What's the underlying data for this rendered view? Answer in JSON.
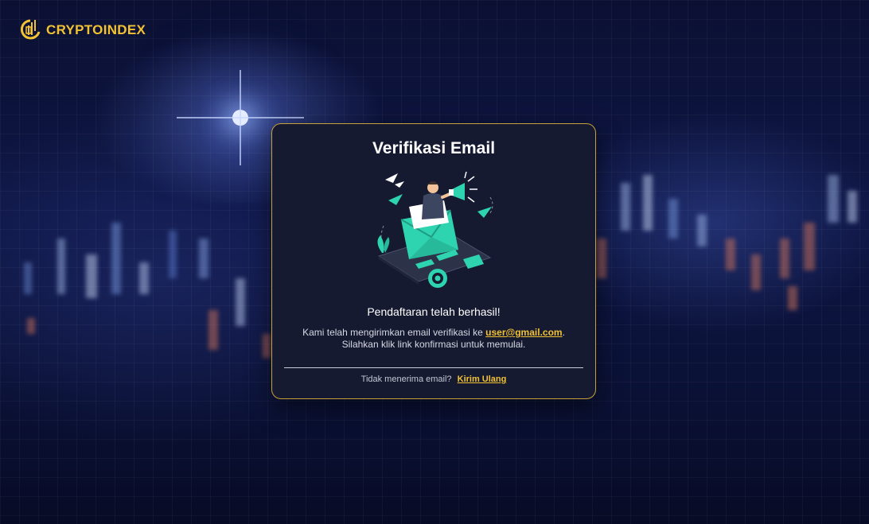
{
  "brand": {
    "name": "CRYPTOINDEX",
    "logo_icon": "coin-chart-icon",
    "accent_color": "#f2c233"
  },
  "card": {
    "title": "Verifikasi Email",
    "illustration": "email-megaphone-illustration",
    "success_message": "Pendaftaran telah berhasil!",
    "info_prefix": "Kami telah mengirimkan email verifikasi ke",
    "email": "user@gmail.com",
    "info_suffix": ".",
    "info_line2": "Silahkan klik link konfirmasi untuk memulai.",
    "footer_prompt": "Tidak menerima email?",
    "resend_label": "Kirim Ulang"
  },
  "colors": {
    "card_background": "#161a31",
    "card_border": "#c9a13a",
    "illustration_teal": "#2ed3b0"
  }
}
